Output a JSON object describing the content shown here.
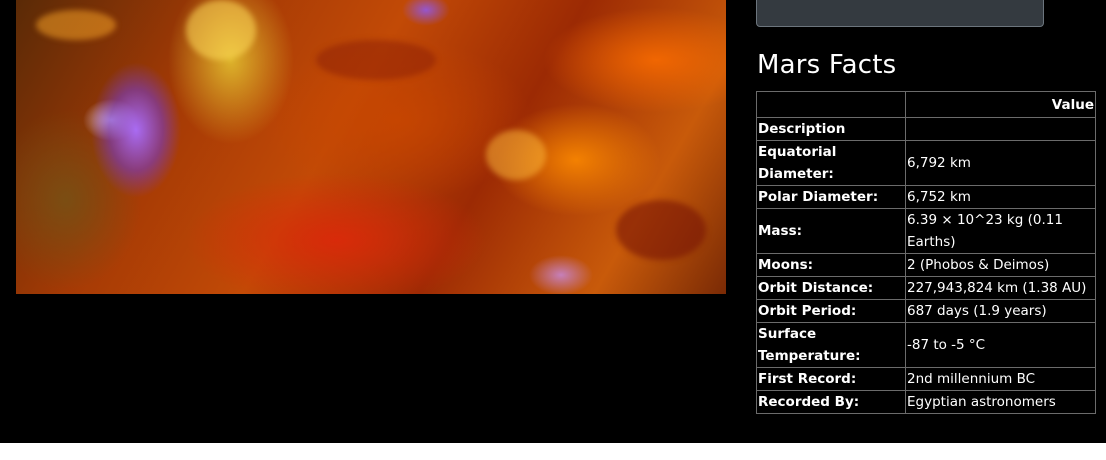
{
  "facts": {
    "title": "Mars Facts",
    "header": {
      "blank": "",
      "value": "Value"
    },
    "rows": [
      {
        "label": "Description",
        "value": ""
      },
      {
        "label": "Equatorial Diameter:",
        "value": "6,792 km"
      },
      {
        "label": "Polar Diameter:",
        "value": "6,752 km"
      },
      {
        "label": "Mass:",
        "value": "6.39 × 10^23 kg (0.11 Earths)"
      },
      {
        "label": "Moons:",
        "value": "2 (Phobos & Deimos)"
      },
      {
        "label": "Orbit Distance:",
        "value": "227,943,824 km (1.38 AU)"
      },
      {
        "label": "Orbit Period:",
        "value": "687 days (1.9 years)"
      },
      {
        "label": "Surface Temperature:",
        "value": "-87 to -5 °C"
      },
      {
        "label": "First Record:",
        "value": "2nd millennium BC"
      },
      {
        "label": "Recorded By:",
        "value": "Egyptian astronomers"
      }
    ]
  },
  "colors": {
    "background": "#000000",
    "button": "#343a40",
    "table_border": "#6b6b6b",
    "text": "#ffffff"
  }
}
